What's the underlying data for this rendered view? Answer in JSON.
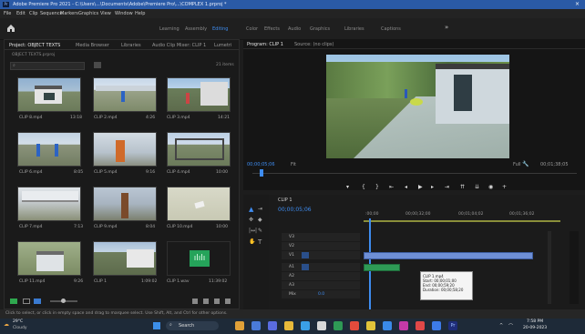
{
  "window": {
    "title": "Adobe Premiere Pro 2021 - C:\\Users\\...\\Documents\\Adobe\\Premiere Pro\\...\\COMPLEX 1.prproj *",
    "close_label": "×"
  },
  "menu": [
    "File",
    "Edit",
    "Clip",
    "Sequence",
    "Markers",
    "Graphics",
    "View",
    "Window",
    "Help"
  ],
  "workspaces": [
    "Learning",
    "Assembly",
    "Editing",
    "Color",
    "Effects",
    "Audio",
    "Graphics",
    "Libraries",
    "Captions"
  ],
  "project": {
    "tabs": [
      "Project: OBJECT TEXTS",
      "Media Browser",
      "Libraries",
      "Audio Clip Mixer: CLIP 1",
      "Lumetri"
    ],
    "path": "OBJECT TEXTS.prproj",
    "item_count": "21 items",
    "clips": [
      {
        "name": "CLIP 8.mp4",
        "dur": "13:18"
      },
      {
        "name": "CLIP 2.mp4",
        "dur": "4:26"
      },
      {
        "name": "CLIP 3.mp4",
        "dur": "14:21"
      },
      {
        "name": "CLIP 6.mp4",
        "dur": "8:05"
      },
      {
        "name": "CLIP 5.mp4",
        "dur": "9:16"
      },
      {
        "name": "CLIP 4.mp4",
        "dur": "10:00"
      },
      {
        "name": "CLIP 7.mp4",
        "dur": "7:13"
      },
      {
        "name": "CLIP 9.mp4",
        "dur": "8:04"
      },
      {
        "name": "CLIP 10.mp4",
        "dur": "10:00"
      },
      {
        "name": "CLIP 11.mp4",
        "dur": "9:26"
      },
      {
        "name": "CLIP 1",
        "dur": "1:09:02"
      },
      {
        "name": "CLIP 1.wav",
        "dur": "11:39:02"
      }
    ]
  },
  "program": {
    "tabs": [
      "Program: CLIP 1",
      "Source: (no clips)"
    ],
    "timecode": "00;00;05;06",
    "fit": "Fit",
    "quality": "Full",
    "duration": "00;01;38;05"
  },
  "timeline": {
    "sequence": "CLIP 1",
    "timecode": "00;00;05;06",
    "ruler": [
      ":00;00",
      "00;00;32;00",
      "00;01;04;02",
      "00;01;36;02"
    ],
    "tracks": [
      "V3",
      "V2",
      "V1",
      "A1",
      "A2",
      "A3",
      "Mix"
    ],
    "mix_value": "0.0",
    "tooltip": {
      "name": "CLIP 1.mp4",
      "start": "Start: 00;00;01;00",
      "end": "End: 00;00;59;20",
      "duration": "Duration: 00;00;58;20"
    }
  },
  "status": "Click to select, or click in empty space and drag to marquee select. Use Shift, Alt, and Ctrl for other options.",
  "taskbar": {
    "weather_temp": "29°C",
    "weather_text": "Cloudy",
    "search": "Search",
    "time": "7:58 PM",
    "date": "20-09-2023"
  }
}
